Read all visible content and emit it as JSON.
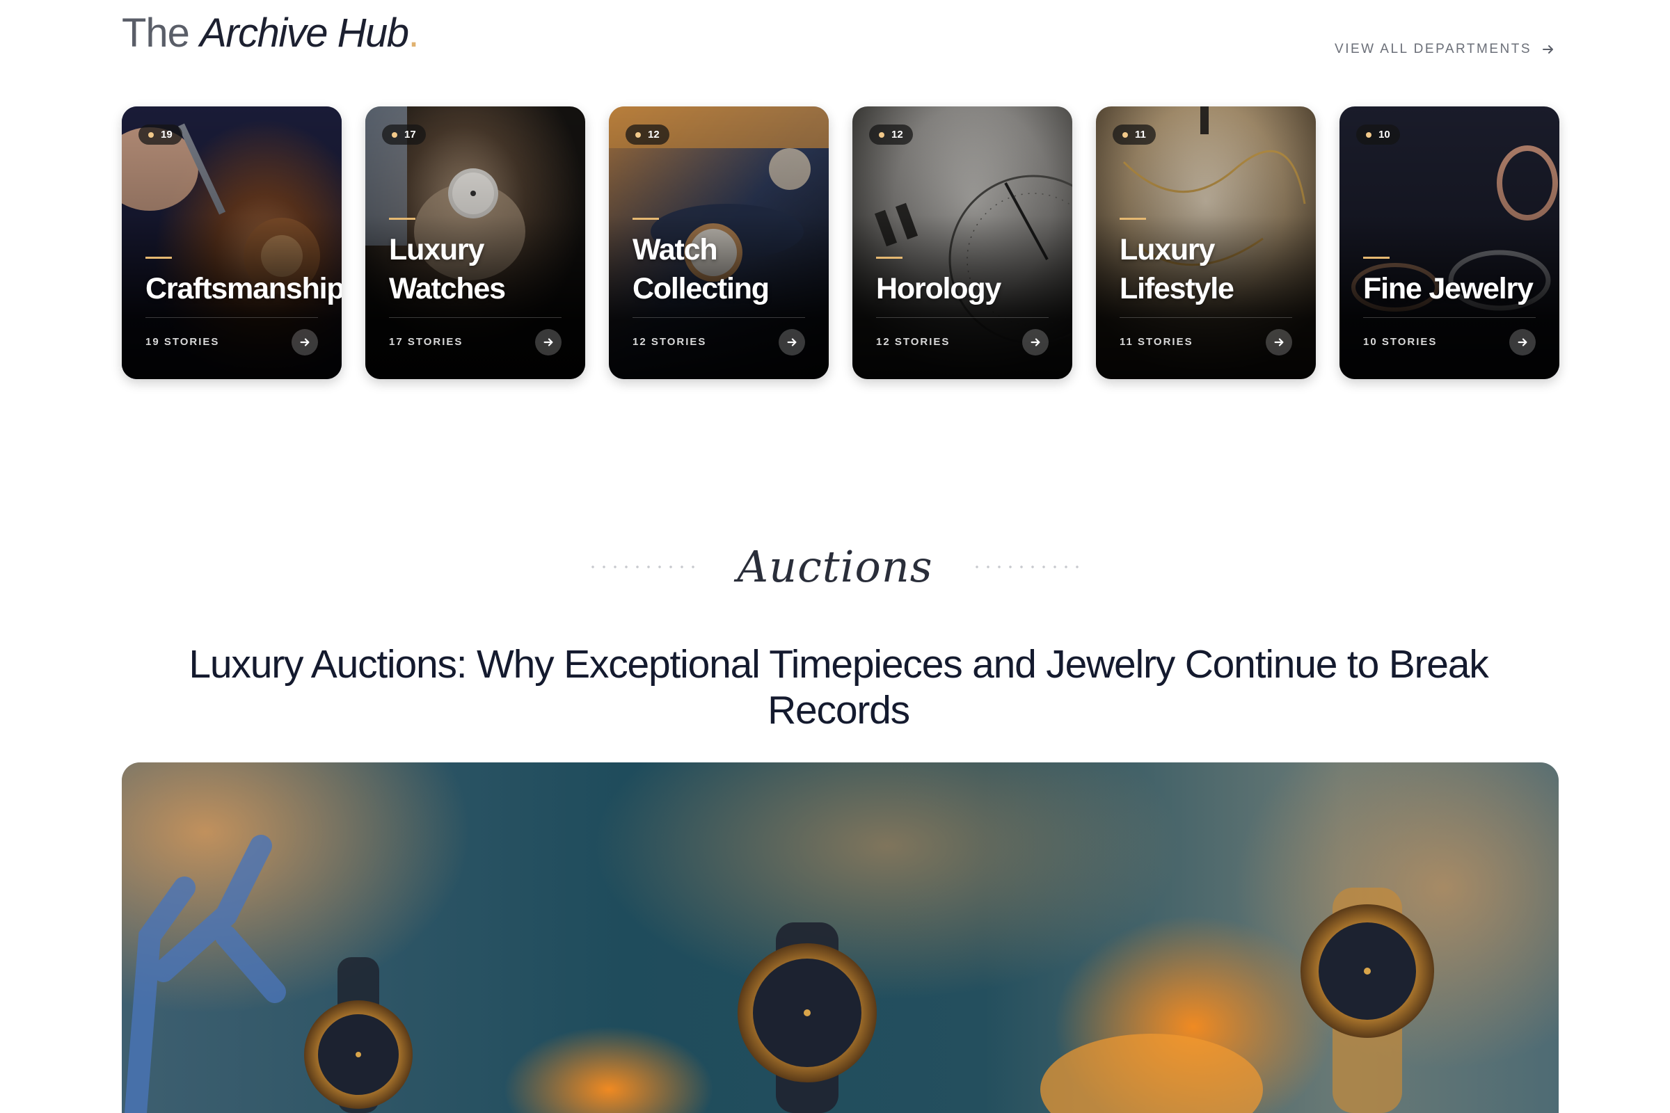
{
  "header": {
    "title_prefix": "The",
    "title_main": "Archive Hub",
    "title_dot": ".",
    "view_all_label": "VIEW ALL DEPARTMENTS"
  },
  "departments": [
    {
      "name_line1": "",
      "name_line2": "Craftsmanship",
      "badge": "19",
      "stories": "19 STORIES"
    },
    {
      "name_line1": "Luxury",
      "name_line2": "Watches",
      "badge": "17",
      "stories": "17 STORIES"
    },
    {
      "name_line1": "Watch",
      "name_line2": "Collecting",
      "badge": "12",
      "stories": "12 STORIES"
    },
    {
      "name_line1": "",
      "name_line2": "Horology",
      "badge": "12",
      "stories": "12 STORIES"
    },
    {
      "name_line1": "Luxury",
      "name_line2": "Lifestyle",
      "badge": "11",
      "stories": "11 STORIES"
    },
    {
      "name_line1": "",
      "name_line2": "Fine Jewelry",
      "badge": "10",
      "stories": "10 STORIES"
    }
  ],
  "auctions": {
    "section_label": "Auctions",
    "headline": "Luxury Auctions: Why Exceptional Timepieces and Jewelry Continue to Break Records"
  },
  "colors": {
    "accent_gold": "#e5b871",
    "headline": "#141a2e",
    "muted": "#6b6f78"
  }
}
